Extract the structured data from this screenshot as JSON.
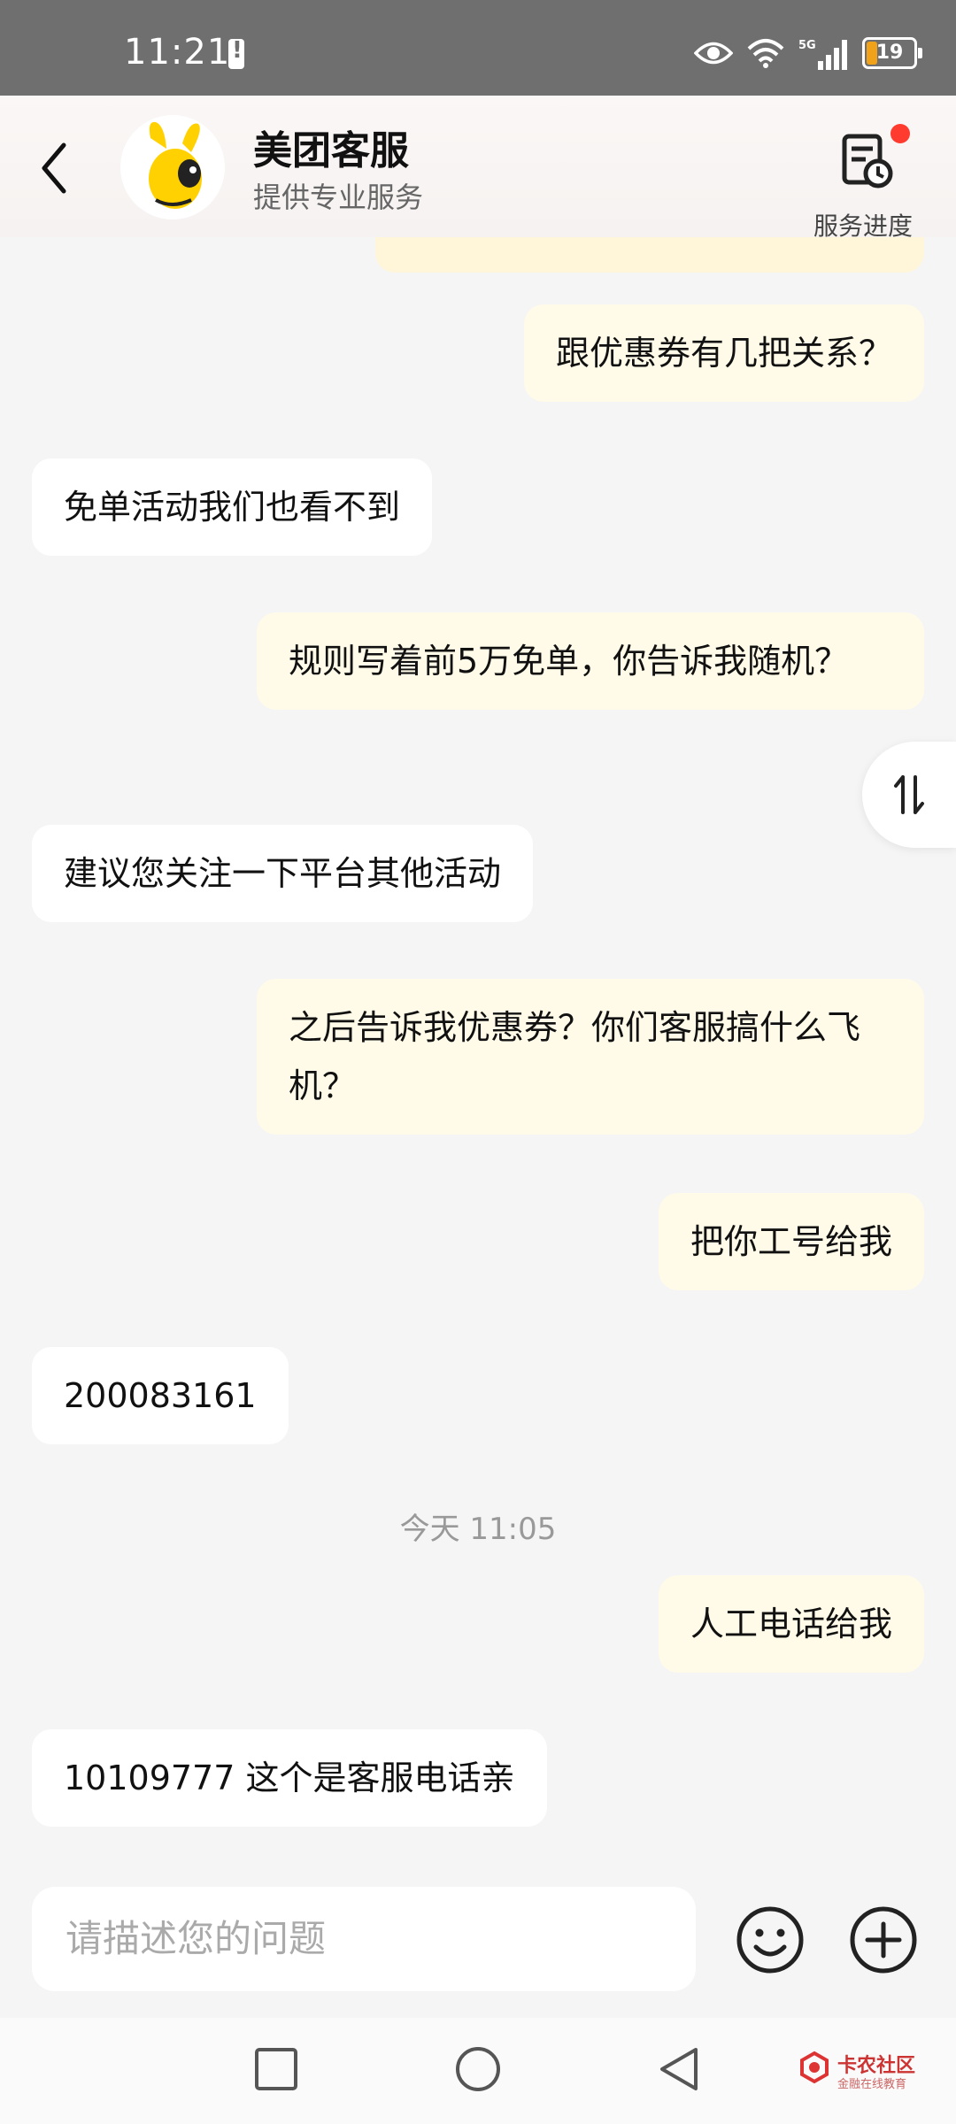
{
  "status_bar": {
    "time": "11:21",
    "battery_level": "19",
    "icons": [
      "alert-icon",
      "eye-icon",
      "wifi-icon",
      "signal-5g-icon",
      "battery-icon"
    ]
  },
  "header": {
    "title": "美团客服",
    "subtitle": "提供专业服务",
    "progress_label": "服务进度",
    "accent_color": "#ff3b30"
  },
  "messages": [
    {
      "from": "user",
      "text": "跟优惠券有几把关系？"
    },
    {
      "from": "agent",
      "text": "免单活动我们也看不到"
    },
    {
      "from": "user",
      "text": "规则写着前5万免单，你告诉我随机？"
    },
    {
      "from": "agent",
      "text": "建议您关注一下平台其他活动"
    },
    {
      "from": "user",
      "text": "之后告诉我优惠券？你们客服搞什么飞机？"
    },
    {
      "from": "user",
      "text": "把你工号给我"
    },
    {
      "from": "agent",
      "text": "200083161"
    },
    {
      "from": "system",
      "text": "今天 11:05"
    },
    {
      "from": "user",
      "text": "人工电话给我"
    },
    {
      "from": "agent",
      "text": "10109777 这个是客服电话亲"
    }
  ],
  "input": {
    "placeholder": "请描述您的问题"
  },
  "watermark": {
    "name": "卡农社区",
    "tagline": "金融在线教育"
  },
  "colors": {
    "user_bubble": "#fffbe8",
    "agent_bubble": "#ffffff",
    "background": "#f5f5f5"
  }
}
